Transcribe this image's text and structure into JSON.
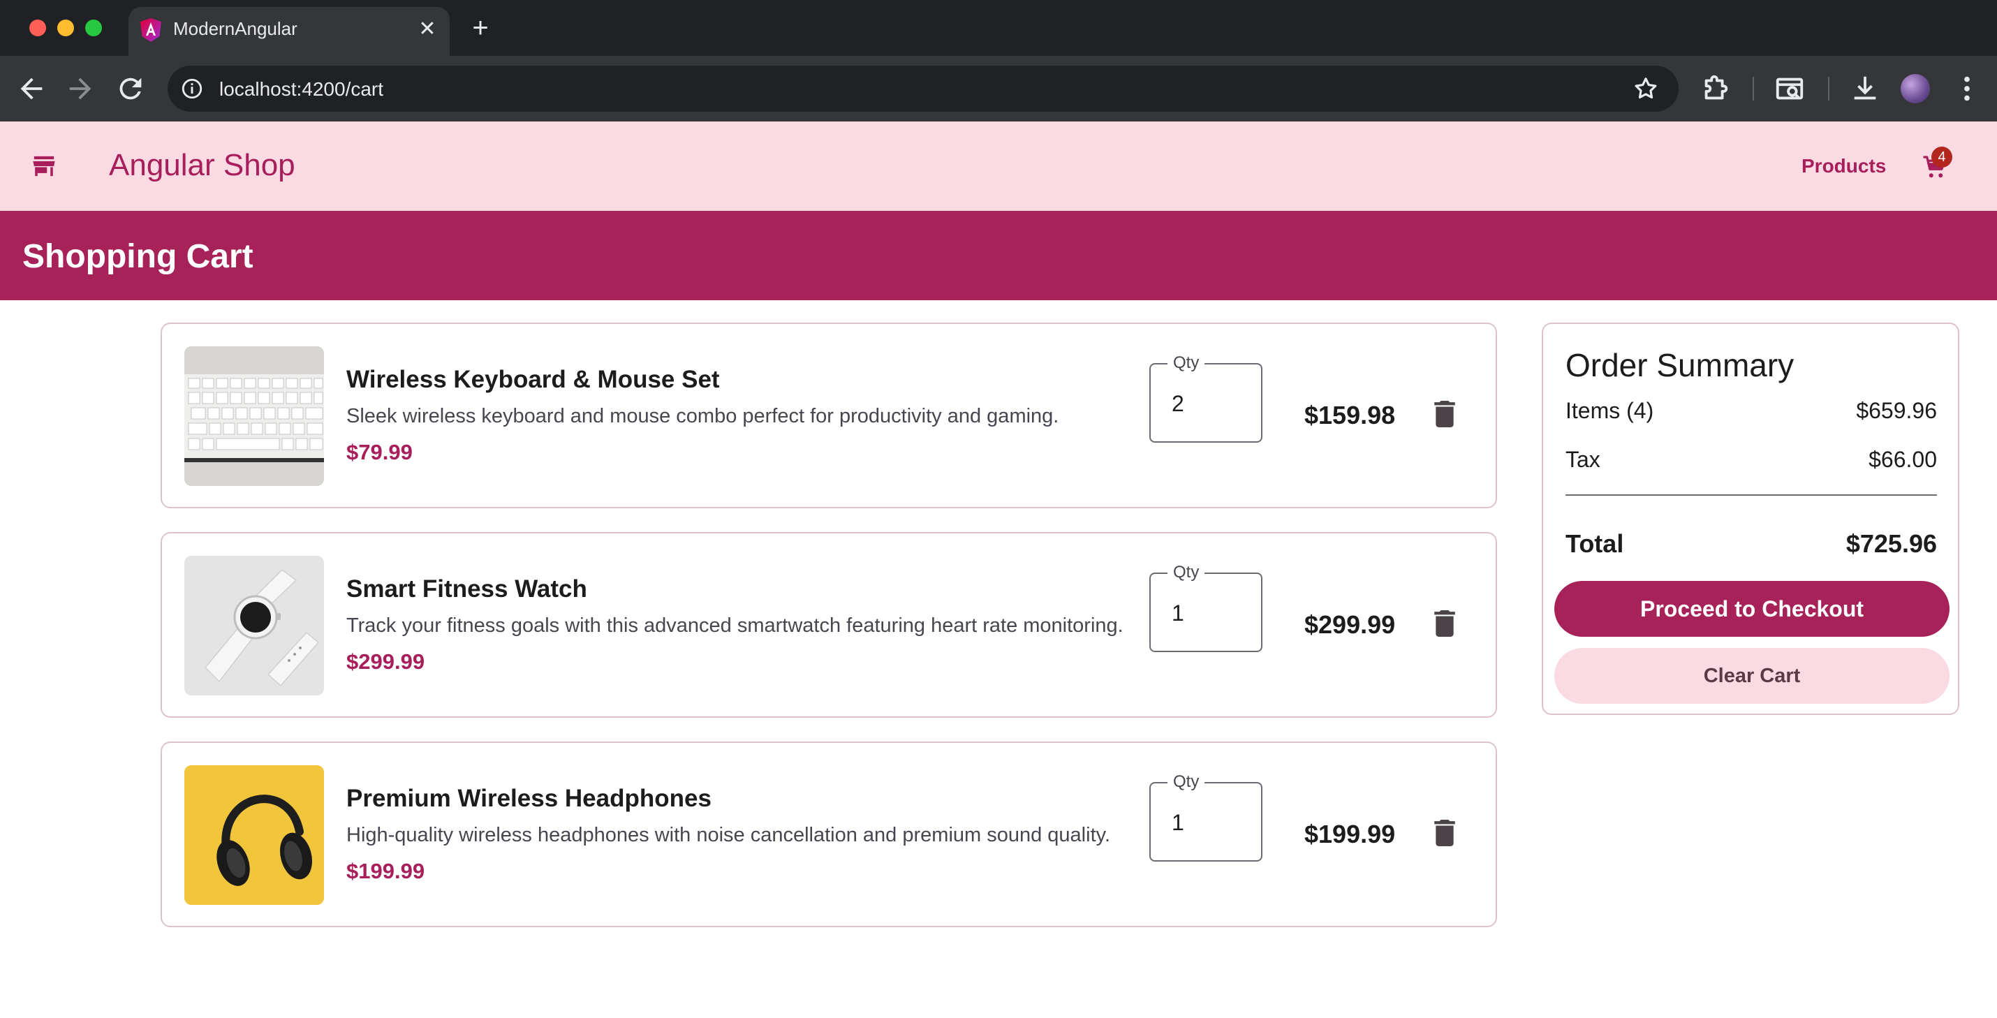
{
  "browser": {
    "tab_title": "ModernAngular",
    "tab_close": "✕",
    "new_tab": "+",
    "url": "localhost:4200/cart"
  },
  "header": {
    "app_title": "Angular Shop",
    "nav_products": "Products",
    "cart_count": "4"
  },
  "page": {
    "title": "Shopping Cart"
  },
  "cart": {
    "qty_label": "Qty",
    "items": [
      {
        "name": "Wireless Keyboard & Mouse Set",
        "description": "Sleek wireless keyboard and mouse combo perfect for productivity and gaming.",
        "price": "$79.99",
        "quantity": "2",
        "line_total": "$159.98",
        "thumbnail": "keyboard-photo"
      },
      {
        "name": "Smart Fitness Watch",
        "description": "Track your fitness goals with this advanced smartwatch featuring heart rate monitoring.",
        "price": "$299.99",
        "quantity": "1",
        "line_total": "$299.99",
        "thumbnail": "smartwatch-photo"
      },
      {
        "name": "Premium Wireless Headphones",
        "description": "High-quality wireless headphones with noise cancellation and premium sound quality.",
        "price": "$199.99",
        "quantity": "1",
        "line_total": "$199.99",
        "thumbnail": "headphones-photo"
      }
    ]
  },
  "summary": {
    "title": "Order Summary",
    "items_label": "Items (4)",
    "items_value": "$659.96",
    "tax_label": "Tax",
    "tax_value": "$66.00",
    "total_label": "Total",
    "total_value": "$725.96",
    "checkout_label": "Proceed to Checkout",
    "clear_label": "Clear Cart"
  },
  "colors": {
    "primary": "#a8225a",
    "primary_container": "#fadbe3",
    "chrome_dark": "#202124"
  }
}
